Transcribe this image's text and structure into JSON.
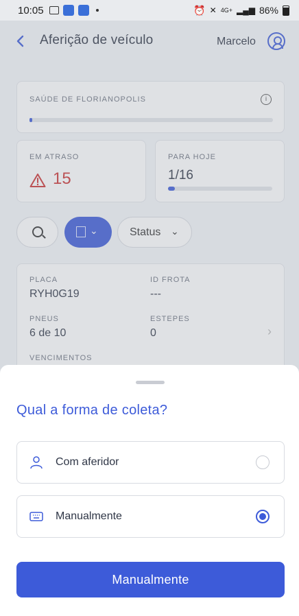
{
  "status_bar": {
    "time": "10:05",
    "network": "4G+",
    "battery": "86%"
  },
  "header": {
    "back_icon": "chevron-left-icon",
    "title": "Aferição de veículo",
    "user_name": "Marcelo",
    "user_icon": "user-circle-icon"
  },
  "org_card": {
    "label": "SAÚDE DE FLORIANOPOLIS",
    "progress": 0.0
  },
  "late_card": {
    "label": "EM ATRASO",
    "value": "15",
    "icon": "warning-triangle-icon"
  },
  "today_card": {
    "label": "PARA HOJE",
    "value": "1/16",
    "progress": 0.0625
  },
  "filters": {
    "search_icon": "search-icon",
    "building_icon": "building-icon",
    "status_label": "Status"
  },
  "vehicle": {
    "plate_label": "PLACA",
    "plate_value": "RYH0G19",
    "fleet_label": "ID FROTA",
    "fleet_value": "---",
    "tires_label": "PNEUS",
    "tires_value": "6 de 10",
    "spares_label": "ESTEPES",
    "spares_value": "0",
    "due_label": "VENCIMENTOS"
  },
  "sheet": {
    "title": "Qual a forma de coleta?",
    "options": [
      {
        "label": "Com aferidor",
        "icon": "user-gauge-icon",
        "selected": false
      },
      {
        "label": "Manualmente",
        "icon": "keyboard-icon",
        "selected": true
      }
    ],
    "confirm_label": "Manualmente"
  },
  "colors": {
    "accent": "#3d5bd9",
    "danger": "#cc3333"
  }
}
